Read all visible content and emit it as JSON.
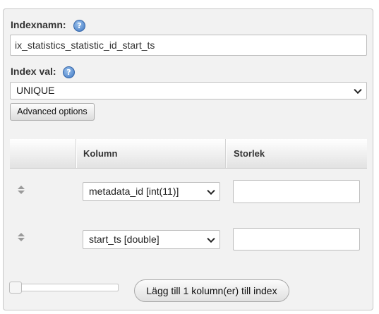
{
  "index_name": {
    "label": "Indexnamn:",
    "value": "ix_statistics_statistic_id_start_ts",
    "help_icon": "?"
  },
  "index_choice": {
    "label": "Index val:",
    "value": "UNIQUE",
    "help_icon": "?"
  },
  "advanced_button": "Advanced options",
  "table": {
    "headers": [
      "",
      "Kolumn",
      "Storlek"
    ],
    "rows": [
      {
        "column": "metadata_id [int(11)]",
        "size": ""
      },
      {
        "column": "start_ts [double]",
        "size": ""
      }
    ]
  },
  "add_button": "Lägg till 1 kolumn(er) till index"
}
